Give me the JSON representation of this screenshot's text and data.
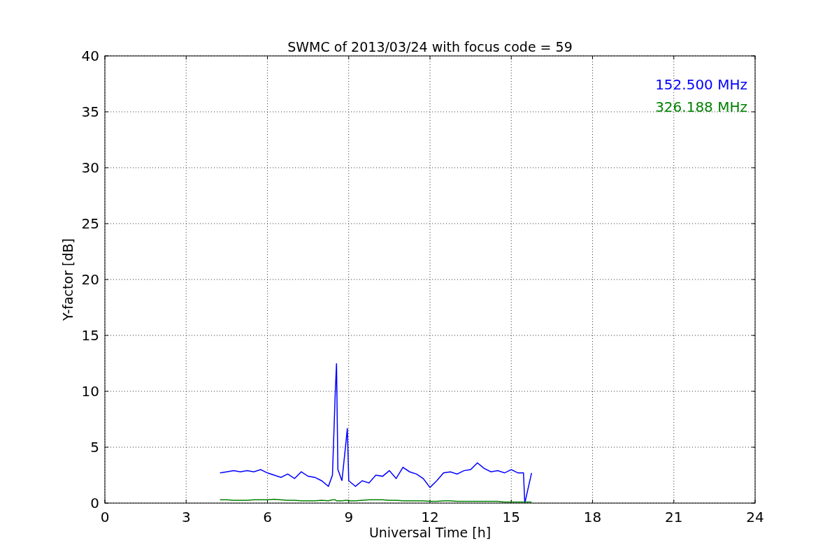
{
  "chart_data": {
    "type": "line",
    "title": "SWMC of 2013/03/24 with focus code = 59",
    "xlabel": "Universal Time [h]",
    "ylabel": "Y-factor [dB]",
    "x": [
      4.25,
      4.5,
      4.75,
      5.0,
      5.25,
      5.5,
      5.75,
      6.0,
      6.25,
      6.5,
      6.75,
      7.0,
      7.25,
      7.5,
      7.75,
      8.0,
      8.25,
      8.4,
      8.5,
      8.55,
      8.6,
      8.75,
      8.9,
      8.95,
      9.0,
      9.25,
      9.5,
      9.75,
      10.0,
      10.25,
      10.5,
      10.75,
      11.0,
      11.25,
      11.5,
      11.75,
      12.0,
      12.25,
      12.5,
      12.75,
      13.0,
      13.25,
      13.5,
      13.75,
      14.0,
      14.25,
      14.5,
      14.75,
      15.0,
      15.25,
      15.45,
      15.5,
      15.75
    ],
    "series": [
      {
        "name": "152.500 MHz",
        "color": "#0000ff",
        "values": [
          2.7,
          2.8,
          2.9,
          2.8,
          2.9,
          2.8,
          3.0,
          2.7,
          2.5,
          2.3,
          2.6,
          2.2,
          2.8,
          2.4,
          2.3,
          2.0,
          1.5,
          2.5,
          9.7,
          12.5,
          3.0,
          2.0,
          5.5,
          6.7,
          2.0,
          1.5,
          2.0,
          1.8,
          2.5,
          2.4,
          2.9,
          2.2,
          3.2,
          2.8,
          2.6,
          2.2,
          1.4,
          2.0,
          2.7,
          2.8,
          2.6,
          2.9,
          3.0,
          3.6,
          3.1,
          2.8,
          2.9,
          2.7,
          3.0,
          2.7,
          2.7,
          0.0,
          2.7
        ]
      },
      {
        "name": "326.188 MHz",
        "color": "#008000",
        "values": [
          0.3,
          0.3,
          0.25,
          0.25,
          0.25,
          0.3,
          0.3,
          0.3,
          0.35,
          0.3,
          0.25,
          0.25,
          0.2,
          0.2,
          0.2,
          0.25,
          0.2,
          0.3,
          0.3,
          0.2,
          0.2,
          0.2,
          0.25,
          0.25,
          0.2,
          0.2,
          0.25,
          0.3,
          0.3,
          0.3,
          0.25,
          0.25,
          0.2,
          0.2,
          0.2,
          0.2,
          0.15,
          0.15,
          0.2,
          0.2,
          0.15,
          0.15,
          0.15,
          0.15,
          0.15,
          0.15,
          0.15,
          0.1,
          0.1,
          0.1,
          0.1,
          0.1,
          0.1
        ]
      }
    ],
    "grid": true,
    "xlim": [
      0,
      24
    ],
    "ylim": [
      0,
      40
    ],
    "xticks": [
      0,
      3,
      6,
      9,
      12,
      15,
      18,
      21,
      24
    ],
    "yticks": [
      0,
      5,
      10,
      15,
      20,
      25,
      30,
      35,
      40
    ]
  }
}
